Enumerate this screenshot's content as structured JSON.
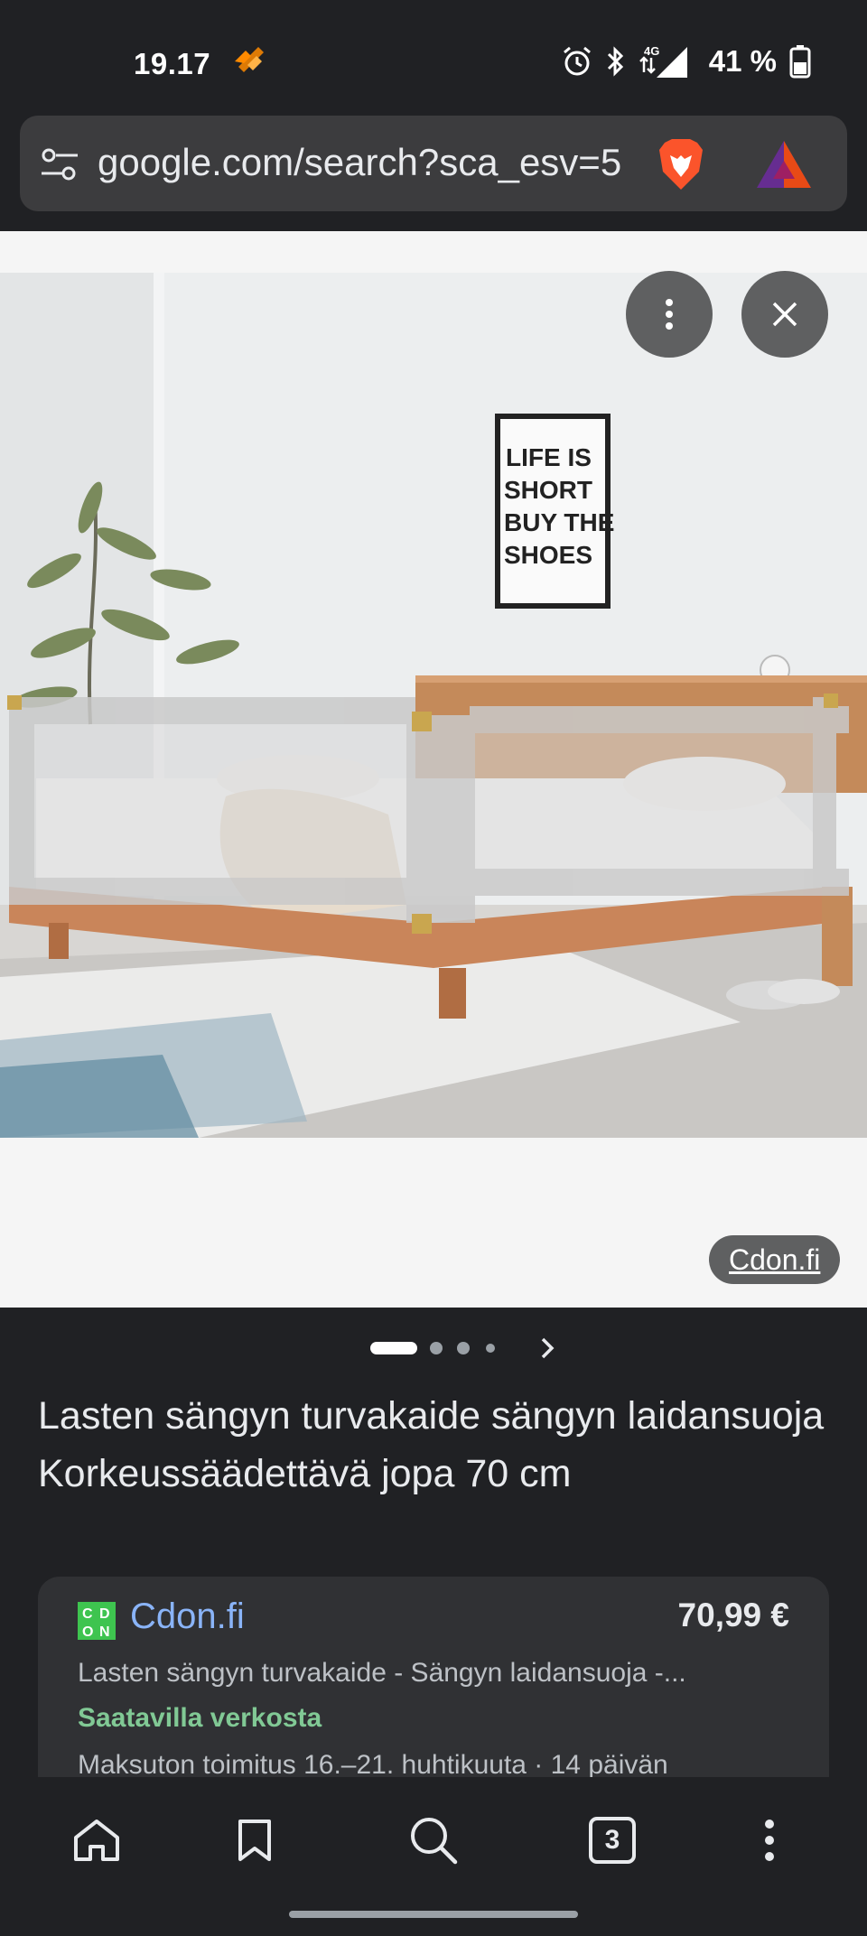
{
  "status_bar": {
    "time": "19.17",
    "network": "4G",
    "battery": "41 %"
  },
  "url_bar": {
    "url": "google.com/search?sca_esv=5"
  },
  "image_viewer": {
    "wall_poster_text": [
      "LIFE IS",
      "SHORT",
      "BUY THE",
      "SHOES"
    ],
    "source_chip": "Cdon.fi",
    "carousel": {
      "current": 1,
      "total": 4
    }
  },
  "product": {
    "title": "Lasten sängyn turvakaide sängyn laidansuoja Korkeussäädettävä jopa 70 cm"
  },
  "result_card": {
    "store_logo_letters": [
      "C",
      "D",
      "O",
      "N"
    ],
    "store_name": "Cdon.fi",
    "price": "70,99 €",
    "description": "Lasten sängyn turvakaide - Sängyn laidansuoja -...",
    "availability": "Saatavilla verkosta",
    "shipping": "Maksuton toimitus 16.–21. huhtikuuta · 14 päivän"
  },
  "bottom_nav": {
    "tab_count": "3",
    "icons": [
      "home-icon",
      "bookmark-icon",
      "search-icon",
      "tabs-icon",
      "more-vert-icon"
    ]
  },
  "colors": {
    "background": "#202124",
    "link_blue": "#8ab4f8",
    "available_green": "#81c995",
    "brave_orange": "#fb542b"
  }
}
